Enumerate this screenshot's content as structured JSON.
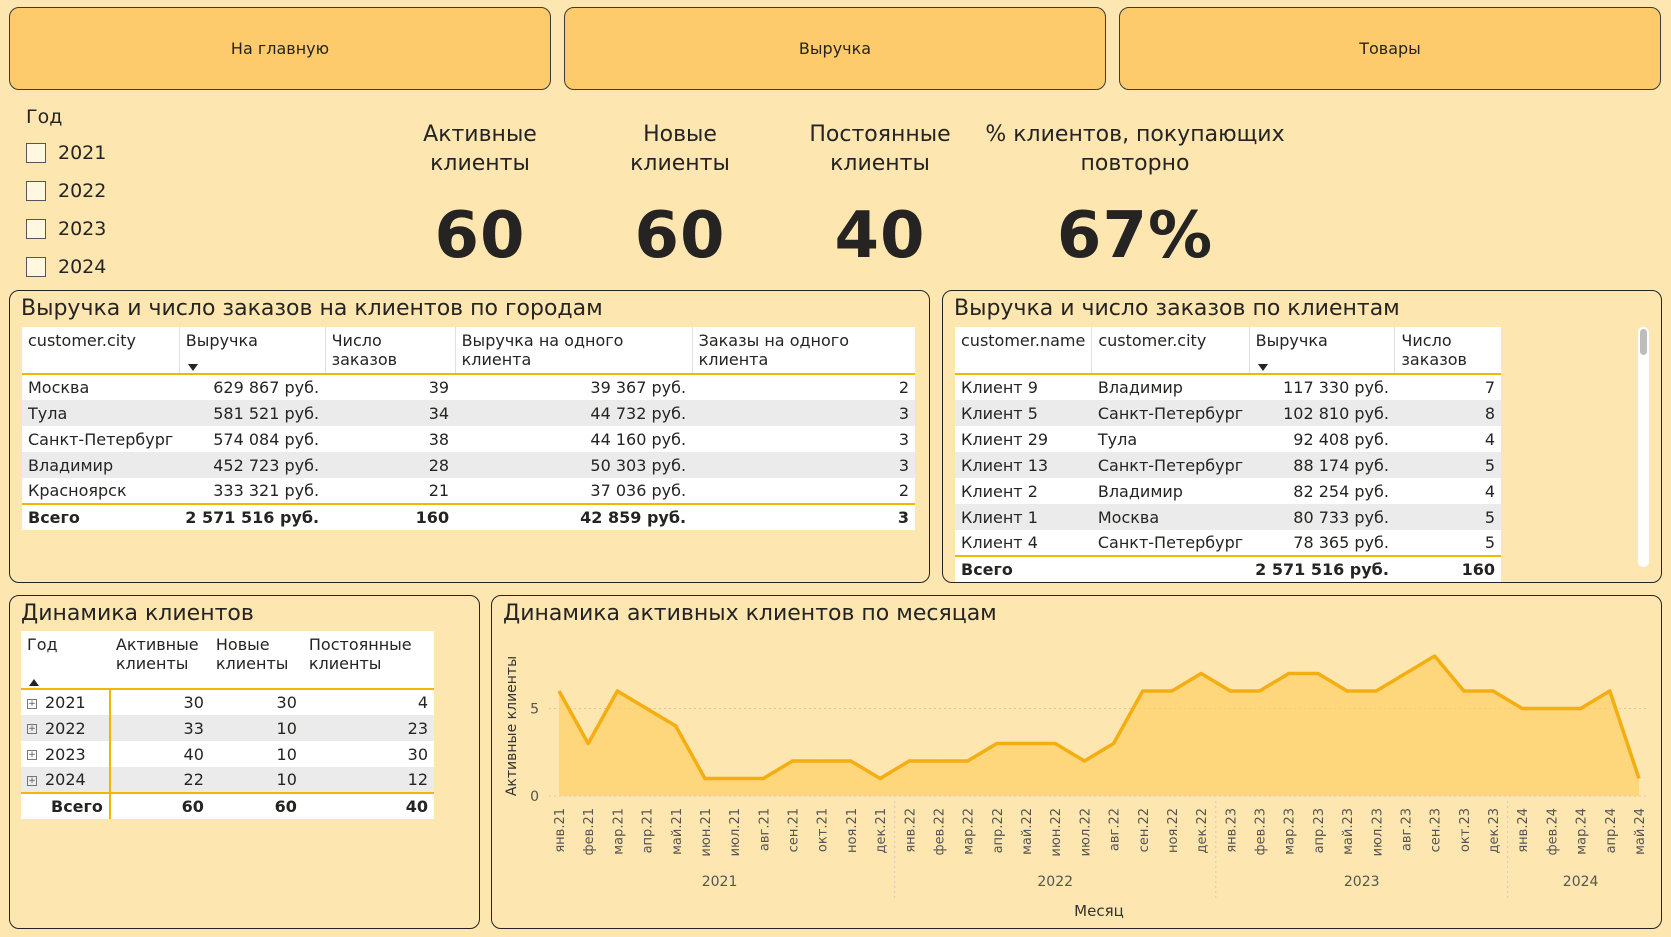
{
  "nav": {
    "home_label": "На главную",
    "revenue_label": "Выручка",
    "products_label": "Товары"
  },
  "year_slicer": {
    "title": "Год",
    "options": [
      "2021",
      "2022",
      "2023",
      "2024"
    ]
  },
  "kpis": {
    "active": {
      "label_line1": "Активные",
      "label_line2": "клиенты",
      "value": "60"
    },
    "new": {
      "label_line1": "Новые",
      "label_line2": "клиенты",
      "value": "60"
    },
    "repeat": {
      "label_line1": "Постоянные",
      "label_line2": "клиенты",
      "value": "40"
    },
    "repeat_pct": {
      "label_line1": "% клиентов, покупающих",
      "label_line2": "повторно",
      "value": "67%"
    }
  },
  "city_table": {
    "title": "Выручка и число заказов на клиентов по городам",
    "headers": [
      "customer.city",
      "Выручка",
      "Число заказов",
      "Выручка на одного клиента",
      "Заказы на одного клиента"
    ],
    "rows": [
      [
        "Москва",
        "629 867 руб.",
        "39",
        "39 367 руб.",
        "2"
      ],
      [
        "Тула",
        "581 521 руб.",
        "34",
        "44 732 руб.",
        "3"
      ],
      [
        "Санкт-Петербург",
        "574 084 руб.",
        "38",
        "44 160 руб.",
        "3"
      ],
      [
        "Владимир",
        "452 723 руб.",
        "28",
        "50 303 руб.",
        "3"
      ],
      [
        "Красноярск",
        "333 321 руб.",
        "21",
        "37 036 руб.",
        "2"
      ]
    ],
    "total": [
      "Всего",
      "2 571 516 руб.",
      "160",
      "42 859 руб.",
      "3"
    ]
  },
  "client_table": {
    "title": "Выручка и число заказов по клиентам",
    "headers": [
      "customer.name",
      "customer.city",
      "Выручка",
      "Число заказов"
    ],
    "rows": [
      [
        "Клиент 9",
        "Владимир",
        "117 330 руб.",
        "7"
      ],
      [
        "Клиент 5",
        "Санкт-Петербург",
        "102 810 руб.",
        "8"
      ],
      [
        "Клиент 29",
        "Тула",
        "92 408 руб.",
        "4"
      ],
      [
        "Клиент 13",
        "Санкт-Петербург",
        "88 174 руб.",
        "5"
      ],
      [
        "Клиент 2",
        "Владимир",
        "82 254 руб.",
        "4"
      ],
      [
        "Клиент 1",
        "Москва",
        "80 733 руб.",
        "5"
      ],
      [
        "Клиент 4",
        "Санкт-Петербург",
        "78 365 руб.",
        "5"
      ]
    ],
    "total": [
      "Всего",
      "",
      "2 571 516 руб.",
      "160"
    ]
  },
  "dynamics_table": {
    "title": "Динамика клиентов",
    "headers": [
      "Год",
      "Активные клиенты",
      "Новые клиенты",
      "Постоянные клиенты"
    ],
    "rows": [
      [
        "2021",
        "30",
        "30",
        "4"
      ],
      [
        "2022",
        "33",
        "10",
        "23"
      ],
      [
        "2023",
        "40",
        "10",
        "30"
      ],
      [
        "2024",
        "22",
        "10",
        "12"
      ]
    ],
    "total": [
      "Всего",
      "60",
      "60",
      "40"
    ]
  },
  "chart_data": {
    "type": "area",
    "title": "Динамика активных клиентов по месяцам",
    "xlabel": "Месяц",
    "ylabel": "Активные клиенты",
    "ylim": [
      0,
      8
    ],
    "yticks": [
      0,
      5
    ],
    "grid": true,
    "x": [
      "янв.21",
      "фев.21",
      "мар.21",
      "апр.21",
      "май.21",
      "июн.21",
      "июл.21",
      "авг.21",
      "сен.21",
      "окт.21",
      "ноя.21",
      "дек.21",
      "янв.22",
      "фев.22",
      "мар.22",
      "апр.22",
      "май.22",
      "июн.22",
      "июл.22",
      "авг.22",
      "сен.22",
      "ноя.22",
      "дек.22",
      "янв.23",
      "фев.23",
      "мар.23",
      "апр.23",
      "май.23",
      "июл.23",
      "авг.23",
      "сен.23",
      "окт.23",
      "дек.23",
      "янв.24",
      "фев.24",
      "мар.24",
      "апр.24",
      "май.24"
    ],
    "values": [
      6,
      3,
      6,
      5,
      4,
      1,
      1,
      1,
      2,
      2,
      2,
      1,
      2,
      2,
      2,
      3,
      3,
      3,
      2,
      3,
      6,
      6,
      7,
      6,
      6,
      7,
      7,
      6,
      6,
      7,
      8,
      6,
      6,
      5,
      5,
      5,
      6,
      1
    ],
    "year_groups": [
      {
        "label": "2021",
        "count": 12
      },
      {
        "label": "2022",
        "count": 11
      },
      {
        "label": "2023",
        "count": 10
      },
      {
        "label": "2024",
        "count": 5
      }
    ],
    "colors": {
      "line": "#f5ae11",
      "fill": "#fdd06b"
    }
  }
}
